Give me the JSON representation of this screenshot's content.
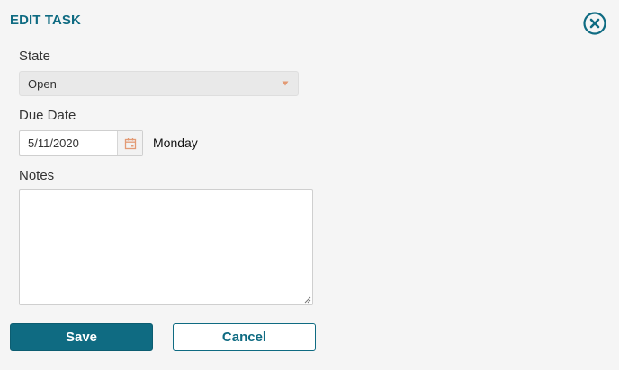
{
  "dialog": {
    "title": "EDIT TASK",
    "close_icon": "close-circle-icon",
    "accent_color": "#0f6b82"
  },
  "fields": {
    "state": {
      "label": "State",
      "value": "Open",
      "icon": "caret-down-icon",
      "icon_color": "#e39a74"
    },
    "due_date": {
      "label": "Due Date",
      "value": "5/11/2020",
      "weekday": "Monday",
      "icon": "calendar-icon",
      "icon_color": "#e39a74"
    },
    "notes": {
      "label": "Notes",
      "value": ""
    }
  },
  "buttons": {
    "save_label": "Save",
    "cancel_label": "Cancel"
  }
}
